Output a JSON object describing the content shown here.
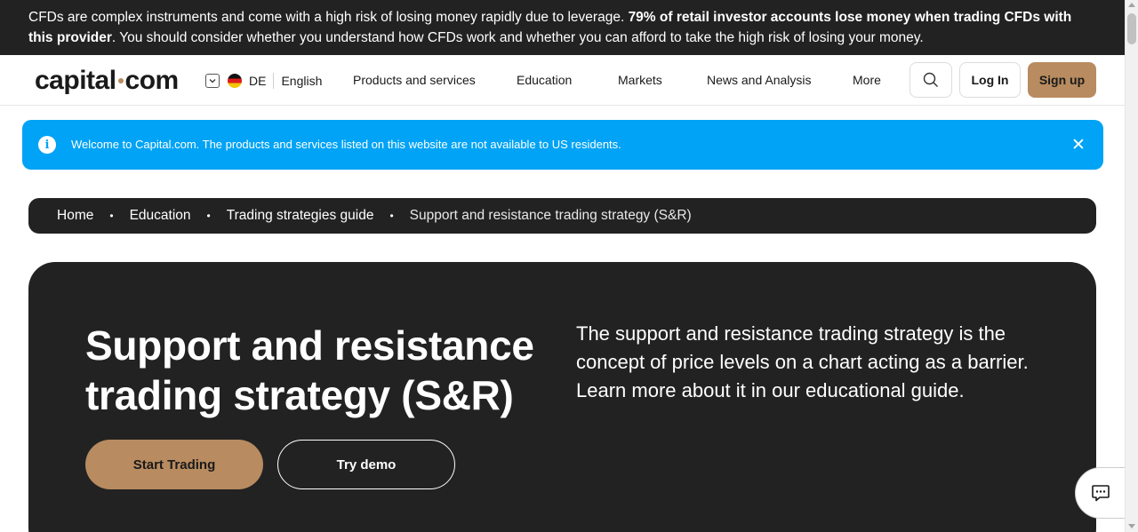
{
  "risk_warning": {
    "text_part1": "CFDs are complex instruments and come with a high risk of losing money rapidly due to leverage. ",
    "bold_part": "79% of retail investor accounts lose money when trading CFDs with this provider",
    "text_part2": ". You should consider whether you understand how CFDs work and whether you can afford to take the high risk of losing your money."
  },
  "header": {
    "logo_left": "capital",
    "logo_right": "com",
    "country_code": "DE",
    "language": "English",
    "nav": [
      "Products and services",
      "Education",
      "Markets",
      "News and Analysis",
      "More"
    ],
    "login_label": "Log In",
    "signup_label": "Sign up"
  },
  "info_banner": {
    "text": "Welcome to Capital.com. The products and services listed on this website are not available to US residents.",
    "icon_glyph": "i",
    "close_glyph": "✕"
  },
  "breadcrumb": {
    "items": [
      "Home",
      "Education",
      "Trading strategies guide"
    ],
    "current": "Support and resistance trading strategy (S&R)",
    "separator": "•"
  },
  "hero": {
    "title": "Support and resistance trading strategy (S&R)",
    "description": "The support and resistance trading strategy is the concept of price levels on a chart acting as a barrier. Learn more about it in our educational guide.",
    "primary_button": "Start Trading",
    "secondary_button": "Try demo"
  },
  "colors": {
    "dark": "#222222",
    "accent": "#b88b60",
    "info_blue": "#00a3f5"
  }
}
